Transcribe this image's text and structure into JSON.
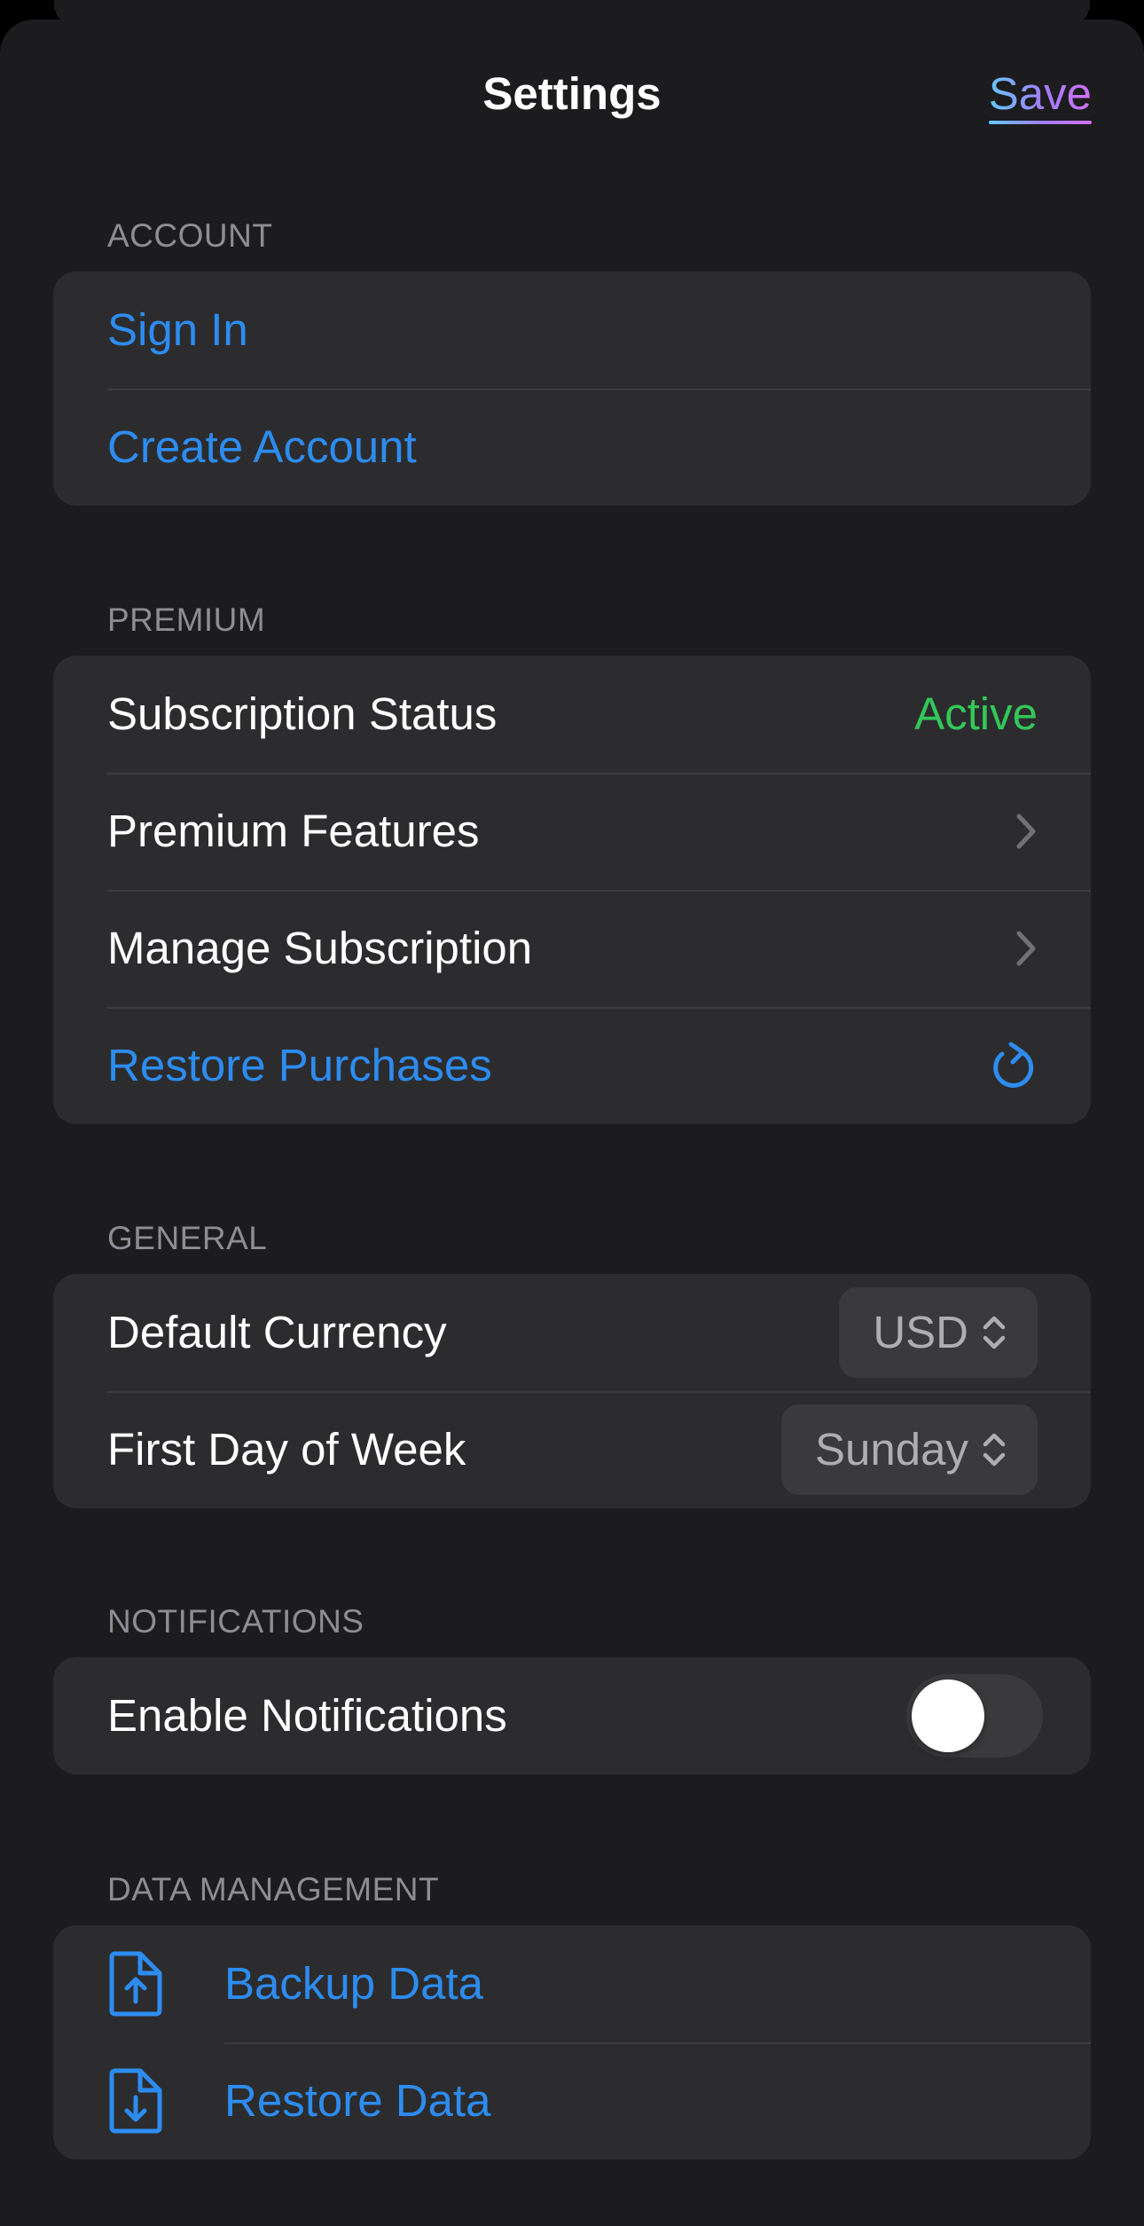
{
  "header": {
    "title": "Settings",
    "save_label": "Save"
  },
  "sections": {
    "account": {
      "header": "ACCOUNT",
      "sign_in": "Sign In",
      "create_account": "Create Account"
    },
    "premium": {
      "header": "PREMIUM",
      "subscription_status_label": "Subscription Status",
      "subscription_status_value": "Active",
      "premium_features": "Premium Features",
      "manage_subscription": "Manage Subscription",
      "restore_purchases": "Restore Purchases"
    },
    "general": {
      "header": "GENERAL",
      "default_currency_label": "Default Currency",
      "default_currency_value": "USD",
      "first_day_label": "First Day of Week",
      "first_day_value": "Sunday"
    },
    "notifications": {
      "header": "NOTIFICATIONS",
      "enable_label": "Enable Notifications",
      "enabled": false
    },
    "data_management": {
      "header": "DATA MANAGEMENT",
      "backup": "Backup Data",
      "restore": "Restore Data"
    }
  },
  "icons": {
    "chevron": "chevron-right-icon",
    "refresh": "refresh-icon",
    "updown": "chevron-up-down-icon",
    "backup": "document-upload-icon",
    "restore": "document-download-icon"
  },
  "colors": {
    "background": "#1c1c1e",
    "group": "#2c2c2e",
    "link": "#2d8cf0",
    "active": "#33c759",
    "secondary": "#8d8d93"
  }
}
